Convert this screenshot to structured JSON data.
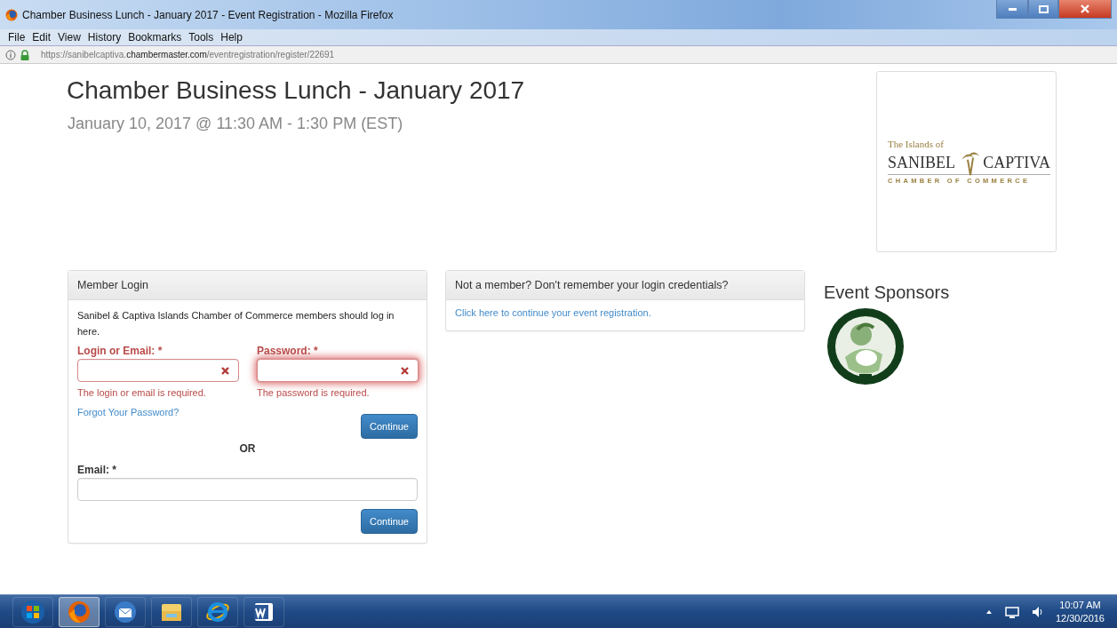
{
  "window": {
    "title": "Chamber Business Lunch - January 2017 - Event Registration - Mozilla Firefox"
  },
  "menu": [
    {
      "label": "File"
    },
    {
      "label": "Edit"
    },
    {
      "label": "View"
    },
    {
      "label": "History"
    },
    {
      "label": "Bookmarks"
    },
    {
      "label": "Tools"
    },
    {
      "label": "Help"
    }
  ],
  "address_bar": {
    "url": "https://sanibelcaptiva.**chambermaster.com**/eventregistration/register/22691"
  },
  "event": {
    "title": "Chamber Business Lunch - January 2017",
    "date": "January 10, 2017 @ 11:30 AM - 1:30 PM (EST)"
  },
  "logo": {
    "top": "The Islands of",
    "left": "SANIBEL",
    "right": "CAPTIVA",
    "bottom": "CHAMBER OF COMMERCE"
  },
  "login": {
    "heading": "Member Login",
    "intro": "Sanibel & Captiva Islands Chamber of Commerce members should log in here.",
    "fields": [
      {
        "label": "Login or Email: *",
        "invalid": true,
        "focused": false,
        "error": "The login or email is required."
      },
      {
        "label": "Password: *",
        "invalid": true,
        "focused": true,
        "error": "The password is required."
      }
    ],
    "forgot_link": "Forgot Your Password?",
    "button": "Continue",
    "separator": "OR",
    "email_field": {
      "label": "Email: *",
      "invalid": false,
      "focused": false
    },
    "email_button": "Continue"
  },
  "guest": {
    "heading": "Not a member? Don't remember your login credentials?",
    "link": "Click here to continue your event registration."
  },
  "sponsors": {
    "heading": "Event Sponsors"
  },
  "taskbar": {
    "apps": [
      {
        "kind": "start",
        "selected": false
      },
      {
        "kind": "firefox",
        "selected": true
      },
      {
        "kind": "mail",
        "selected": false
      },
      {
        "kind": "folder",
        "selected": false
      },
      {
        "kind": "ie",
        "selected": false
      },
      {
        "kind": "word",
        "selected": false
      }
    ],
    "time": "10:07 AM",
    "date": "12/30/2016"
  }
}
